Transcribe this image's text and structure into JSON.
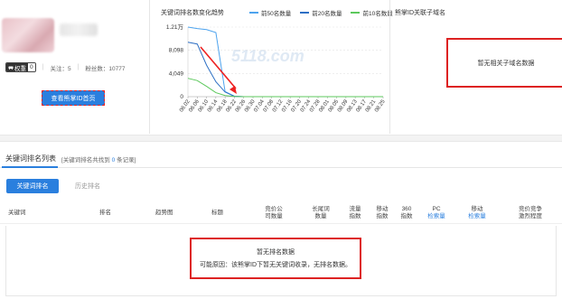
{
  "profile": {
    "weight_label": "权重",
    "weight_value": "0",
    "follow_label": "关注：",
    "follow_value": "5",
    "fans_label": "粉丝数：",
    "fans_value": "10777",
    "view_button": "查看熊掌ID首页"
  },
  "trend_chart": {
    "title": "关键词排名数变化趋势",
    "legend": [
      {
        "name": "前50名数量",
        "color": "#4da3ee"
      },
      {
        "name": "前20名数量",
        "color": "#2d6fc4"
      },
      {
        "name": "前10名数量",
        "color": "#5cc85c"
      }
    ],
    "watermark": "5118.com",
    "y_ticks": [
      "0",
      "4,049",
      "8,098",
      "1.21万"
    ],
    "chart_data": {
      "type": "line",
      "x": [
        "06.02",
        "06.06",
        "06.10",
        "06.14",
        "06.18",
        "06.22",
        "06.26",
        "06.30",
        "07.04",
        "07.08",
        "07.12",
        "07.16",
        "07.20",
        "07.24",
        "07.28",
        "08.01",
        "08.05",
        "08.09",
        "08.13",
        "08.17",
        "08.21",
        "08.25"
      ],
      "ylim": [
        0,
        12146
      ],
      "series": [
        {
          "name": "前50名数量",
          "values": [
            12146,
            11900,
            11700,
            11200,
            900,
            80,
            0,
            0,
            0,
            0,
            0,
            0,
            0,
            0,
            0,
            0,
            0,
            0,
            0,
            0,
            0,
            0
          ]
        },
        {
          "name": "前20名数量",
          "values": [
            9500,
            9200,
            5500,
            2600,
            800,
            60,
            0,
            0,
            0,
            0,
            0,
            0,
            0,
            0,
            0,
            0,
            0,
            0,
            0,
            0,
            0,
            0
          ]
        },
        {
          "name": "前10名数量",
          "values": [
            3200,
            2800,
            1800,
            700,
            200,
            30,
            0,
            0,
            0,
            0,
            0,
            0,
            0,
            0,
            0,
            0,
            0,
            0,
            0,
            0,
            0,
            0
          ]
        }
      ]
    }
  },
  "subdomain": {
    "title": "熊掌ID关联子域名",
    "empty_text": "暂无相关子域名数据"
  },
  "ranking": {
    "title": "关键词排名列表",
    "note_prefix": "[关键词排名共找到",
    "note_count": "0",
    "note_suffix": "条记录]",
    "tab_active": "关键词排名",
    "tab_history": "历史排名",
    "columns": {
      "keyword": "关键词",
      "rank": "排名",
      "trend": "趋势图",
      "title": "标题",
      "bid_line1": "竞价公",
      "bid_line2": "司数量",
      "longtail_line1": "长尾词",
      "longtail_line2": "数量",
      "traffic_line1": "流量",
      "traffic_line2": "指数",
      "mobile_line1": "移动",
      "mobile_line2": "指数",
      "s360_line1": "360",
      "s360_line2": "指数",
      "pc_line1": "PC",
      "pc_line2": "检索量",
      "mob_search_line1": "移动",
      "mob_search_line2": "检索量",
      "competition_line1": "竞价竞争",
      "competition_line2": "激烈程度"
    },
    "empty_title": "暂无排名数据",
    "empty_reason": "可能原因：该熊掌ID下暂无关键词收录，无排名数据。"
  }
}
